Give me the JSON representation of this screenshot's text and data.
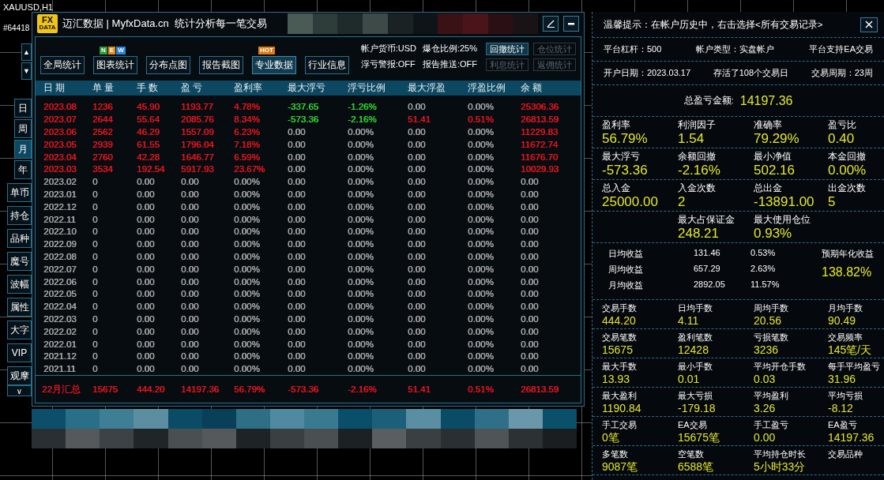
{
  "chart": {
    "symbol": "XAUUSD,H1",
    "label": "#64418"
  },
  "rail": {
    "arrows": [
      "▲",
      "▼"
    ],
    "periods": [
      {
        "label": "日",
        "selected": false
      },
      {
        "label": "周",
        "selected": false
      },
      {
        "label": "月",
        "selected": true
      },
      {
        "label": "年",
        "selected": false
      }
    ],
    "tools": [
      "单币",
      "持仓",
      "品种",
      "魔号",
      "波幅",
      "属性",
      "大字",
      "VIP",
      "观摩"
    ],
    "more": "∨"
  },
  "window": {
    "logo": [
      "FX",
      "DATA"
    ],
    "title": "迈汇数据 | MyfxData.cn  统计分析每一笔交易",
    "toolbar": [
      {
        "label": "全局统计",
        "selected": false
      },
      {
        "label": "图表统计",
        "selected": false,
        "badge": [
          {
            "text": "N",
            "color": "#2e9a3c"
          },
          {
            "text": "E",
            "color": "#e08a1a"
          },
          {
            "text": "W",
            "color": "#2a86d6"
          }
        ]
      },
      {
        "label": "分布点图",
        "selected": false
      },
      {
        "label": "报告截图",
        "selected": false
      },
      {
        "label": "专业数据",
        "selected": true,
        "badge": [
          {
            "text": "HOT",
            "color": "#e07a12"
          }
        ]
      },
      {
        "label": "行业信息",
        "selected": false
      }
    ],
    "info": [
      "帐户货币:USD",
      "爆仓比例:25%",
      "浮亏警报:OFF",
      "报告推送:OFF"
    ],
    "side_buttons": [
      {
        "label": "回撤统计",
        "disabled": false
      },
      {
        "label": "仓位统计",
        "disabled": true
      },
      {
        "label": "利息统计",
        "disabled": true
      },
      {
        "label": "返佣统计",
        "disabled": true
      }
    ],
    "table": {
      "columns": [
        "日 期",
        "单 量",
        "手 数",
        "盈 亏",
        "盈利率",
        "最大浮亏",
        "浮亏比例",
        "最大浮盈",
        "浮盈比例",
        "余 额"
      ],
      "rows": [
        {
          "cells": [
            {
              "text": "2023.08",
              "color": "#e8161e"
            },
            {
              "text": "1236",
              "color": "#e8161e"
            },
            {
              "text": "45.90",
              "color": "#e8161e"
            },
            {
              "text": "1193.77",
              "color": "#e8161e"
            },
            {
              "text": "4.78%",
              "color": "#e8161e"
            },
            {
              "text": "-337.65",
              "color": "#32d432"
            },
            {
              "text": "-1.26%",
              "color": "#32d432"
            },
            {
              "text": "0.00",
              "color": "#a9a9a9"
            },
            {
              "text": "0.00%",
              "color": "#a9a9a9"
            },
            {
              "text": "25306.36",
              "color": "#e8161e"
            }
          ]
        },
        {
          "cells": [
            {
              "text": "2023.07",
              "color": "#e8161e"
            },
            {
              "text": "2644",
              "color": "#e8161e"
            },
            {
              "text": "55.64",
              "color": "#e8161e"
            },
            {
              "text": "2085.76",
              "color": "#e8161e"
            },
            {
              "text": "8.34%",
              "color": "#e8161e"
            },
            {
              "text": "-573.36",
              "color": "#32d432"
            },
            {
              "text": "-2.16%",
              "color": "#32d432"
            },
            {
              "text": "51.41",
              "color": "#e8161e"
            },
            {
              "text": "0.51%",
              "color": "#e8161e"
            },
            {
              "text": "26813.59",
              "color": "#e8161e"
            }
          ]
        },
        {
          "cells": [
            {
              "text": "2023.06",
              "color": "#e8161e"
            },
            {
              "text": "2562",
              "color": "#e8161e"
            },
            {
              "text": "46.29",
              "color": "#e8161e"
            },
            {
              "text": "1557.09",
              "color": "#e8161e"
            },
            {
              "text": "6.23%",
              "color": "#e8161e"
            },
            {
              "text": "0.00",
              "color": "#a9a9a9"
            },
            {
              "text": "0.00%",
              "color": "#a9a9a9"
            },
            {
              "text": "0.00",
              "color": "#a9a9a9"
            },
            {
              "text": "0.00%",
              "color": "#a9a9a9"
            },
            {
              "text": "11229.83",
              "color": "#e8161e"
            }
          ]
        },
        {
          "cells": [
            {
              "text": "2023.05",
              "color": "#e8161e"
            },
            {
              "text": "2939",
              "color": "#e8161e"
            },
            {
              "text": "61.55",
              "color": "#e8161e"
            },
            {
              "text": "1796.04",
              "color": "#e8161e"
            },
            {
              "text": "7.18%",
              "color": "#e8161e"
            },
            {
              "text": "0.00",
              "color": "#a9a9a9"
            },
            {
              "text": "0.00%",
              "color": "#a9a9a9"
            },
            {
              "text": "0.00",
              "color": "#a9a9a9"
            },
            {
              "text": "0.00%",
              "color": "#a9a9a9"
            },
            {
              "text": "11672.74",
              "color": "#e8161e"
            }
          ]
        },
        {
          "cells": [
            {
              "text": "2023.04",
              "color": "#e8161e"
            },
            {
              "text": "2760",
              "color": "#e8161e"
            },
            {
              "text": "42.28",
              "color": "#e8161e"
            },
            {
              "text": "1646.77",
              "color": "#e8161e"
            },
            {
              "text": "6.59%",
              "color": "#e8161e"
            },
            {
              "text": "0.00",
              "color": "#a9a9a9"
            },
            {
              "text": "0.00%",
              "color": "#a9a9a9"
            },
            {
              "text": "0.00",
              "color": "#a9a9a9"
            },
            {
              "text": "0.00%",
              "color": "#a9a9a9"
            },
            {
              "text": "11676.70",
              "color": "#e8161e"
            }
          ]
        },
        {
          "cells": [
            {
              "text": "2023.03",
              "color": "#e8161e"
            },
            {
              "text": "3534",
              "color": "#e8161e"
            },
            {
              "text": "192.54",
              "color": "#e8161e"
            },
            {
              "text": "5917.93",
              "color": "#e8161e"
            },
            {
              "text": "23.67%",
              "color": "#e8161e"
            },
            {
              "text": "0.00",
              "color": "#a9a9a9"
            },
            {
              "text": "0.00%",
              "color": "#a9a9a9"
            },
            {
              "text": "0.00",
              "color": "#a9a9a9"
            },
            {
              "text": "0.00%",
              "color": "#a9a9a9"
            },
            {
              "text": "10029.93",
              "color": "#e8161e"
            }
          ]
        },
        {
          "values": [
            "2023.02",
            "0",
            "0.00",
            "0.00",
            "0.00%",
            "0.00",
            "0.00%",
            "0.00",
            "0.00%",
            "0.00"
          ],
          "color": "#a9a9a9"
        },
        {
          "values": [
            "2023.01",
            "0",
            "0.00",
            "0.00",
            "0.00%",
            "0.00",
            "0.00%",
            "0.00",
            "0.00%",
            "0.00"
          ],
          "color": "#a9a9a9"
        },
        {
          "values": [
            "2022.12",
            "0",
            "0.00",
            "0.00",
            "0.00%",
            "0.00",
            "0.00%",
            "0.00",
            "0.00%",
            "0.00"
          ],
          "color": "#a9a9a9"
        },
        {
          "values": [
            "2022.11",
            "0",
            "0.00",
            "0.00",
            "0.00%",
            "0.00",
            "0.00%",
            "0.00",
            "0.00%",
            "0.00"
          ],
          "color": "#a9a9a9"
        },
        {
          "values": [
            "2022.10",
            "0",
            "0.00",
            "0.00",
            "0.00%",
            "0.00",
            "0.00%",
            "0.00",
            "0.00%",
            "0.00"
          ],
          "color": "#a9a9a9"
        },
        {
          "values": [
            "2022.09",
            "0",
            "0.00",
            "0.00",
            "0.00%",
            "0.00",
            "0.00%",
            "0.00",
            "0.00%",
            "0.00"
          ],
          "color": "#a9a9a9"
        },
        {
          "values": [
            "2022.08",
            "0",
            "0.00",
            "0.00",
            "0.00%",
            "0.00",
            "0.00%",
            "0.00",
            "0.00%",
            "0.00"
          ],
          "color": "#a9a9a9"
        },
        {
          "values": [
            "2022.07",
            "0",
            "0.00",
            "0.00",
            "0.00%",
            "0.00",
            "0.00%",
            "0.00",
            "0.00%",
            "0.00"
          ],
          "color": "#a9a9a9"
        },
        {
          "values": [
            "2022.06",
            "0",
            "0.00",
            "0.00",
            "0.00%",
            "0.00",
            "0.00%",
            "0.00",
            "0.00%",
            "0.00"
          ],
          "color": "#a9a9a9"
        },
        {
          "values": [
            "2022.05",
            "0",
            "0.00",
            "0.00",
            "0.00%",
            "0.00",
            "0.00%",
            "0.00",
            "0.00%",
            "0.00"
          ],
          "color": "#a9a9a9"
        },
        {
          "values": [
            "2022.04",
            "0",
            "0.00",
            "0.00",
            "0.00%",
            "0.00",
            "0.00%",
            "0.00",
            "0.00%",
            "0.00"
          ],
          "color": "#a9a9a9"
        },
        {
          "values": [
            "2022.03",
            "0",
            "0.00",
            "0.00",
            "0.00%",
            "0.00",
            "0.00%",
            "0.00",
            "0.00%",
            "0.00"
          ],
          "color": "#a9a9a9"
        },
        {
          "values": [
            "2022.02",
            "0",
            "0.00",
            "0.00",
            "0.00%",
            "0.00",
            "0.00%",
            "0.00",
            "0.00%",
            "0.00"
          ],
          "color": "#a9a9a9"
        },
        {
          "values": [
            "2022.01",
            "0",
            "0.00",
            "0.00",
            "0.00%",
            "0.00",
            "0.00%",
            "0.00",
            "0.00%",
            "0.00"
          ],
          "color": "#a9a9a9"
        },
        {
          "values": [
            "2021.12",
            "0",
            "0.00",
            "0.00",
            "0.00%",
            "0.00",
            "0.00%",
            "0.00",
            "0.00%",
            "0.00"
          ],
          "color": "#a9a9a9"
        },
        {
          "values": [
            "2021.11",
            "0",
            "0.00",
            "0.00",
            "0.00%",
            "0.00",
            "0.00%",
            "0.00",
            "0.00%",
            "0.00"
          ],
          "color": "#a9a9a9"
        }
      ],
      "summary": {
        "values": [
          "22月汇总",
          "15675",
          "444.20",
          "14197.36",
          "56.79%",
          "-573.36",
          "-2.16%",
          "51.41",
          "0.51%",
          "26813.59"
        ],
        "color": "#e8161e"
      }
    }
  },
  "panel": {
    "tip": "温馨提示：在帐户历史中，右击选择<所有交易记录>",
    "info_rows": [
      [
        "平台杠杆：500",
        "帐户类型：实盘帐户",
        "平台支持EA交易"
      ],
      [
        "开户日期：2023.03.17",
        "存活了108个交易日",
        "交易周期：23周"
      ]
    ],
    "total": {
      "label": "总盈亏金额:",
      "value": "14197.36"
    },
    "key_stats": [
      [
        {
          "label": "盈利率",
          "value": "56.79%"
        },
        {
          "label": "利润因子",
          "value": "1.54"
        },
        {
          "label": "准确率",
          "value": "79.29%"
        },
        {
          "label": "盈亏比",
          "value": "0.40"
        }
      ],
      [
        {
          "label": "最大浮亏",
          "value": "-573.36"
        },
        {
          "label": "余额回撤",
          "value": "-2.16%"
        },
        {
          "label": "最小净值",
          "value": "502.16"
        },
        {
          "label": "本金回撤",
          "value": "0.00%"
        }
      ],
      [
        {
          "label": "总入金",
          "value": "25000.00"
        },
        {
          "label": "入金次数",
          "value": "2"
        },
        {
          "label": "总出金",
          "value": "-13891.00"
        },
        {
          "label": "出金次数",
          "value": "5"
        }
      ],
      [
        {
          "label": "最大占保证金",
          "value": "248.21"
        },
        {
          "label": "最大使用仓位",
          "value": "0.93%"
        }
      ]
    ],
    "averages": {
      "rows": [
        [
          "日均收益",
          "131.46",
          "0.53%"
        ],
        [
          "周均收益",
          "657.29",
          "2.63%"
        ],
        [
          "月均收益",
          "2892.05",
          "11.57%"
        ]
      ],
      "label": "预期年化收益",
      "value": "138.82%"
    },
    "stats": [
      [
        {
          "label": "交易手数",
          "value": "444.20"
        },
        {
          "label": "日均手数",
          "value": "4.11"
        },
        {
          "label": "周均手数",
          "value": "20.56"
        },
        {
          "label": "月均手数",
          "value": "90.49"
        }
      ],
      [
        {
          "label": "交易笔数",
          "value": "15675"
        },
        {
          "label": "盈利笔数",
          "value": "12428"
        },
        {
          "label": "亏损笔数",
          "value": "3236"
        },
        {
          "label": "交易频率",
          "value": "145笔/天"
        }
      ],
      [
        {
          "label": "最大手数",
          "value": "13.93"
        },
        {
          "label": "最小手数",
          "value": "0.01"
        },
        {
          "label": "平均开仓手数",
          "value": "0.03"
        },
        {
          "label": "每手平均盈亏",
          "value": "31.96"
        }
      ],
      [
        {
          "label": "最大盈利",
          "value": "1190.84"
        },
        {
          "label": "最大亏损",
          "value": "-179.18"
        },
        {
          "label": "平均盈利",
          "value": "3.26"
        },
        {
          "label": "平均亏损",
          "value": "-8.12"
        }
      ],
      [
        {
          "label": "手工交易",
          "value": "0笔"
        },
        {
          "label": "EA交易",
          "value": "15675笔"
        },
        {
          "label": "手工盈亏",
          "value": "0.00"
        },
        {
          "label": "EA盈亏",
          "value": "14197.36"
        }
      ],
      [
        {
          "label": "多笔数",
          "value": "9087笔"
        },
        {
          "label": "空笔数",
          "value": "6588笔"
        },
        {
          "label": "平均持仓时长",
          "value": "5小时33分"
        },
        {
          "label": "交易品种"
        }
      ]
    ]
  }
}
